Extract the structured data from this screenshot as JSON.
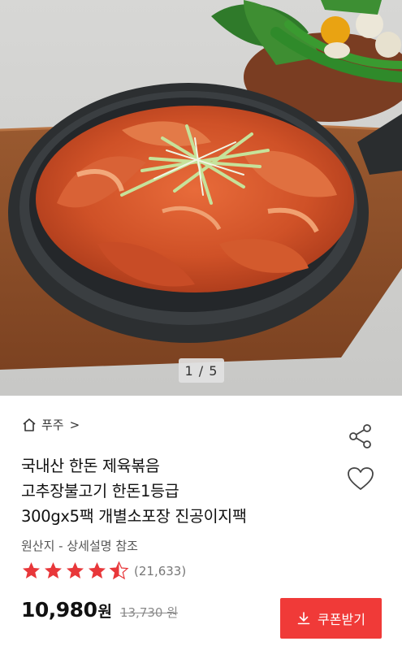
{
  "hero": {
    "image_alt": "product photo",
    "counter": "1 / 5"
  },
  "brand": {
    "name": "푸주",
    "chevron": ">"
  },
  "product": {
    "title_lines": [
      "국내산 한돈 제육볶음",
      "고추장불고기 한돈1등급",
      "300gx5팩 개별소포장 진공이지팩"
    ],
    "origin": "원산지 - 상세설명 참조"
  },
  "rating": {
    "stars": 4.5,
    "max_stars": 5,
    "review_count": "(21,633)"
  },
  "price": {
    "sale": "10,980",
    "currency": "원",
    "original": "13,730 원"
  },
  "actions": {
    "coupon_label": "쿠폰받기"
  },
  "colors": {
    "accent": "#f03a38",
    "star": "#e8373a"
  },
  "icons": [
    "home-icon",
    "share-icon",
    "heart-icon",
    "star-icon",
    "download-icon"
  ]
}
